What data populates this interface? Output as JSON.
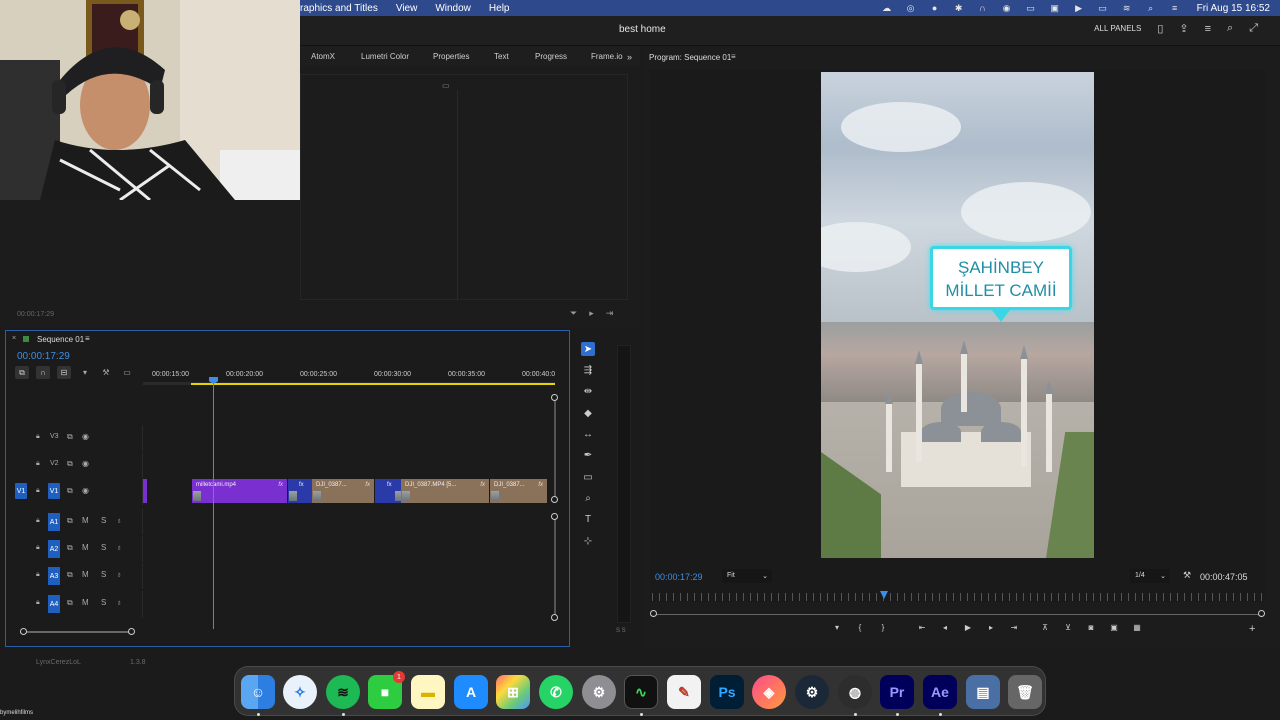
{
  "menubar": {
    "menus": [
      "raphics and Titles",
      "View",
      "Window",
      "Help"
    ],
    "clock": "Fri Aug 15  16:52"
  },
  "header": {
    "project_title": "best home",
    "all_panels": "ALL PANELS"
  },
  "top_tabs": [
    "AtomX",
    "Lumetri Color",
    "Properties",
    "Text",
    "Progress",
    "Frame.io"
  ],
  "left_panel": {
    "timecode": "00:00:17:29"
  },
  "timeline": {
    "sequence_name": "Sequence 01",
    "timecode": "00:00:17:29",
    "ruler_labels": [
      "00:00:15:00",
      "00:00:20:00",
      "00:00:25:00",
      "00:00:30:00",
      "00:00:35:00",
      "00:00:40:0"
    ],
    "video_tracks": [
      {
        "name": "V3"
      },
      {
        "name": "V2"
      },
      {
        "name": "V1",
        "source": "V1"
      }
    ],
    "audio_tracks": [
      {
        "name": "A1",
        "m": "M",
        "s": "S"
      },
      {
        "name": "A2",
        "m": "M",
        "s": "S"
      },
      {
        "name": "A3",
        "m": "M",
        "s": "S"
      },
      {
        "name": "A4",
        "m": "M",
        "s": "S"
      }
    ],
    "clips": [
      {
        "label": "milletcami.mp4",
        "fx": "fx"
      },
      {
        "label": "fx",
        "fx": ""
      },
      {
        "label": "DJI_0387...",
        "fx": "fx"
      },
      {
        "label": "fx",
        "fx": ""
      },
      {
        "label": "DJI_0387.MP4 [5...",
        "fx": "fx"
      },
      {
        "label": "DJI_0387...",
        "fx": "fx"
      }
    ]
  },
  "program": {
    "title": "Program: Sequence 01",
    "overlay_text_line1": "ŞAHİNBEY",
    "overlay_text_line2": "MİLLET CAMİİ",
    "timecode": "00:00:17:29",
    "fit": "Fit",
    "resolution": "1/4",
    "duration": "00:00:47:05"
  },
  "meter_label": "S S",
  "bottom_strip": {
    "left_text": "LynxCerezLoL",
    "right_text": "1.3.8"
  },
  "dock": {
    "items": [
      "finder",
      "safari",
      "spotify",
      "facetime",
      "notes",
      "app-store",
      "launchpad",
      "whatsapp",
      "system-settings",
      "activity-monitor",
      "scripts",
      "Ps",
      "cleaner",
      "steam",
      "obs",
      "Pr",
      "Ae",
      "downloads",
      "trash"
    ],
    "facetime_badge": "1"
  },
  "streamer_name": "bymelihfilms"
}
